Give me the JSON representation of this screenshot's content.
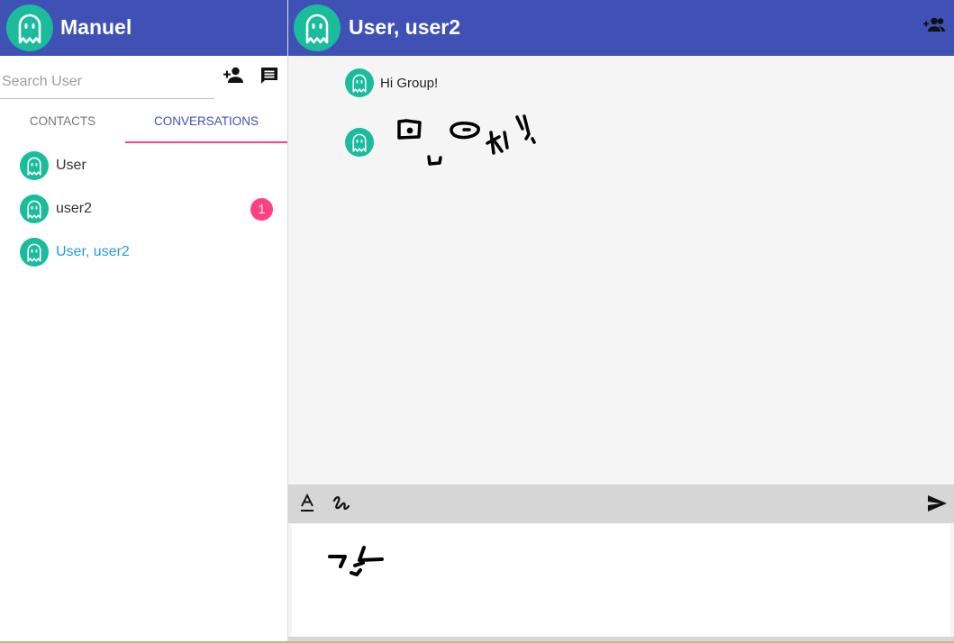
{
  "app": {
    "user_name": "Manuel",
    "colors": {
      "primary": "#3f51b5",
      "accent": "#ff4081",
      "avatar": "#1abc9c",
      "selected_text": "#1e9ed8"
    }
  },
  "search": {
    "placeholder": "Search User",
    "value": ""
  },
  "toolbar_icons": [
    "person-add-icon",
    "new-chat-icon"
  ],
  "tabs": [
    {
      "label": "CONTACTS",
      "active": false
    },
    {
      "label": "CONVERSATIONS",
      "active": true
    }
  ],
  "conversations": [
    {
      "name": "User",
      "unread": null,
      "selected": false
    },
    {
      "name": "user2",
      "unread": "1",
      "selected": false
    },
    {
      "name": "User, user2",
      "unread": null,
      "selected": true
    }
  ],
  "chat": {
    "title": "User, user2",
    "header_icon": "group-add-icon",
    "messages": [
      {
        "type": "text",
        "text": "Hi Group!"
      },
      {
        "type": "drawing"
      }
    ]
  },
  "composer": {
    "tool_icons": [
      "text-format-icon",
      "draw-icon"
    ],
    "send_icon": "send-icon"
  }
}
